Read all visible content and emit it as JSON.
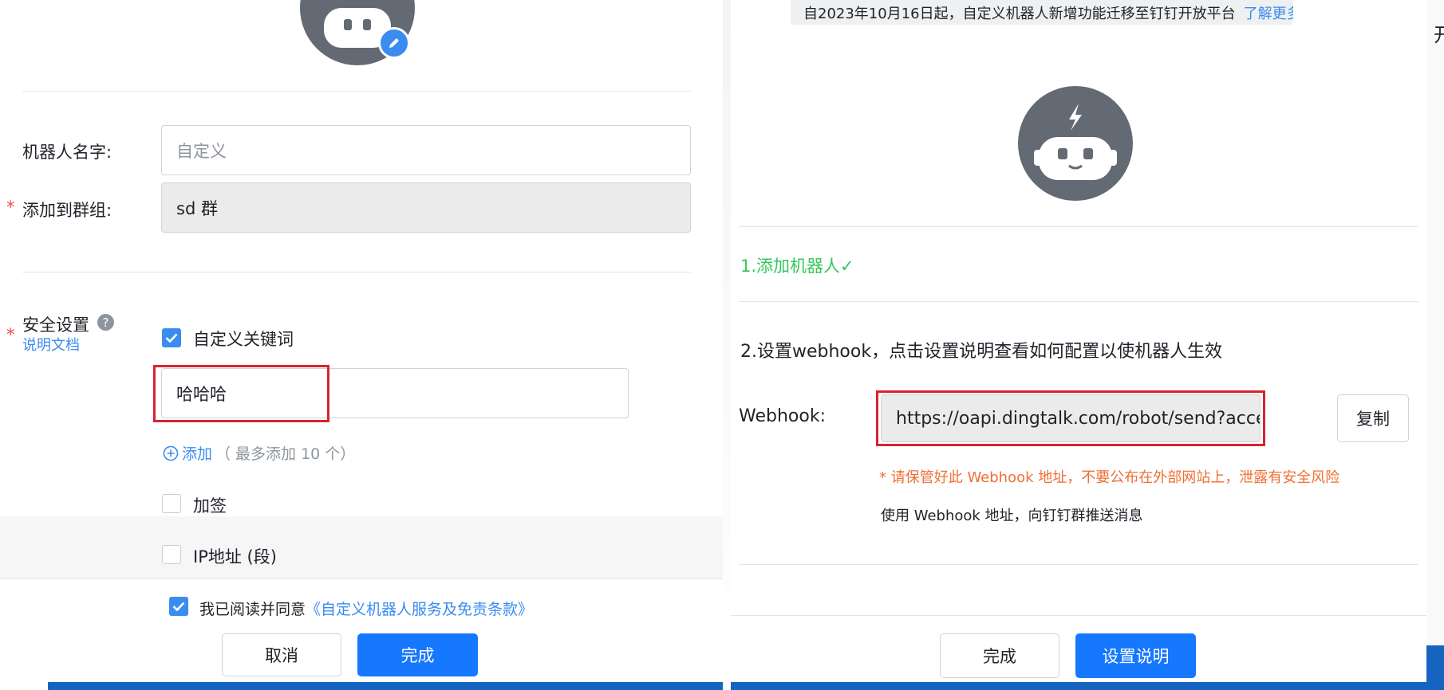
{
  "left_dialog": {
    "robot_name_label": "机器人名字:",
    "robot_name_placeholder": "自定义",
    "group_required_mark": "*",
    "group_label": "添加到群组:",
    "group_value": "sd 群",
    "security_required_mark": "*",
    "security_label": "安全设置",
    "security_doc_link": "说明文档",
    "keyword_option_label": "自定义关键词",
    "keyword_value": "哈哈哈",
    "add_link": "添加",
    "add_hint": "（ 最多添加 10 个）",
    "sign_option_label": "加签",
    "ip_option_label": "IP地址 (段)",
    "agree_text": "我已阅读并同意",
    "agree_link": "《自定义机器人服务及免责条款》",
    "cancel_button": "取消",
    "finish_button": "完成"
  },
  "right_dialog": {
    "notice_text": "自2023年10月16日起，自定义机器人新增功能迁移至钉钉开放平台",
    "notice_link": "了解更多",
    "step1": "1.添加机器人✓",
    "step2": "2.设置webhook，点击设置说明查看如何配置以使机器人生效",
    "webhook_label": "Webhook:",
    "webhook_value": "https://oapi.dingtalk.com/robot/send?access_to",
    "copy_button": "复制",
    "warning": "* 请保管好此 Webhook 地址，不要公布在外部网站上，泄露有安全风险",
    "usage_text": "使用 Webhook 地址，向钉钉群推送消息",
    "finish_button": "完成",
    "setup_guide_button": "设置说明"
  },
  "edge_char": "开",
  "colors": {
    "primary": "#1677ff",
    "success": "#34c759",
    "warning": "#ef6f35",
    "required": "#f54a45",
    "highlight_box": "#d9232e",
    "avatar": "#646a73"
  },
  "icons": [
    "edit-pencil-icon",
    "robot-icon",
    "help-icon",
    "plus-circle-icon",
    "checkmark-icon"
  ]
}
